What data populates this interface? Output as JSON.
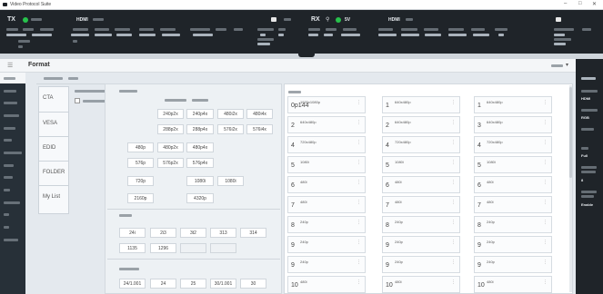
{
  "window": {
    "title": "Video Protocol Suite",
    "controls": [
      "–",
      "□",
      "✕"
    ]
  },
  "status": {
    "tx": {
      "label": "TX",
      "led_color": "#27c24c",
      "interface": "HDMI"
    },
    "rx": {
      "label": "RX",
      "led_color": "#27c24c",
      "voltage": "5V",
      "interface": "HDMI"
    }
  },
  "panel": {
    "title": "Format"
  },
  "vtabs": [
    "CTA",
    "VESA",
    "EDID",
    "FOLDER",
    "My List"
  ],
  "resolution_grid": [
    [
      "240p2x",
      "240p4x",
      "480i2x",
      "480i4x"
    ],
    [
      "288p2x",
      "288p4x",
      "576i2x",
      "576i4x"
    ],
    [
      "480p",
      "480p2x",
      "480p4x"
    ],
    [
      "576p",
      "576p2x",
      "576p4x"
    ],
    [
      "720p",
      "1080i",
      "1080i"
    ],
    [
      "2160p",
      "4320p"
    ]
  ],
  "grid_row_labels": [
    "",
    "",
    "",
    "",
    "",
    "",
    ""
  ],
  "button_rows": {
    "a": [
      "24i",
      "2i3",
      "3t2",
      "313",
      "314"
    ],
    "b": [
      "1135",
      "1296"
    ],
    "c": [
      "24/1.001",
      "24",
      "25",
      "30/1.001",
      "30"
    ]
  },
  "timings": {
    "cards": [
      {
        "id": "0p144",
        "title": "1920x1080p"
      },
      {
        "id": "1",
        "title": "640x480p"
      },
      {
        "id": "1",
        "title": "640x480p"
      },
      {
        "id": "2",
        "title": "640x480p"
      },
      {
        "id": "2",
        "title": "640x480p"
      },
      {
        "id": "3",
        "title": "640x480p"
      },
      {
        "id": "4",
        "title": "720x480p"
      },
      {
        "id": "4",
        "title": "720x480p"
      },
      {
        "id": "4",
        "title": "720x480p"
      },
      {
        "id": "5",
        "title": "1080i"
      },
      {
        "id": "5",
        "title": "1080i"
      },
      {
        "id": "5",
        "title": "1080i"
      },
      {
        "id": "6",
        "title": "480i"
      },
      {
        "id": "6",
        "title": "480i"
      },
      {
        "id": "6",
        "title": "480i"
      },
      {
        "id": "7",
        "title": "480i"
      },
      {
        "id": "7",
        "title": "480i"
      },
      {
        "id": "7",
        "title": "480i"
      },
      {
        "id": "8",
        "title": "240p"
      },
      {
        "id": "8",
        "title": "240p"
      },
      {
        "id": "8",
        "title": "240p"
      },
      {
        "id": "9",
        "title": "240p"
      },
      {
        "id": "9",
        "title": "240p"
      },
      {
        "id": "9",
        "title": "240p"
      },
      {
        "id": "9",
        "title": "240p"
      },
      {
        "id": "9",
        "title": "240p"
      },
      {
        "id": "9",
        "title": "240p"
      },
      {
        "id": "10",
        "title": "480i"
      },
      {
        "id": "10",
        "title": "480i"
      },
      {
        "id": "10",
        "title": "480i"
      }
    ]
  },
  "rightpanel": {
    "values": [
      "HDMI",
      "RGB",
      "Full",
      "Enable"
    ]
  }
}
